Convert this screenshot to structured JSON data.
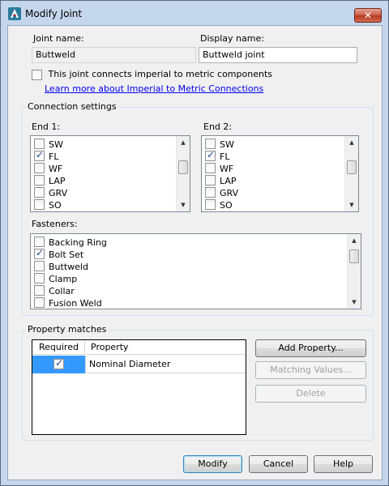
{
  "window": {
    "title": "Modify Joint",
    "close_icon": "✕"
  },
  "joint": {
    "name_label": "Joint name:",
    "name_value": "Buttweld",
    "display_label": "Display name:",
    "display_value": "Buttweld joint",
    "imperial_label": "This joint connects imperial to metric components",
    "imperial_checked": false,
    "learn_more": "Learn more about Imperial to Metric Connections"
  },
  "connection": {
    "group_title": "Connection settings",
    "end1_label": "End 1:",
    "end2_label": "End 2:",
    "end1_items": [
      {
        "label": "SW",
        "checked": false
      },
      {
        "label": "FL",
        "checked": true
      },
      {
        "label": "WF",
        "checked": false
      },
      {
        "label": "LAP",
        "checked": false
      },
      {
        "label": "GRV",
        "checked": false
      },
      {
        "label": "SO",
        "checked": false
      }
    ],
    "end2_items": [
      {
        "label": "SW",
        "checked": false
      },
      {
        "label": "FL",
        "checked": true
      },
      {
        "label": "WF",
        "checked": false
      },
      {
        "label": "LAP",
        "checked": false
      },
      {
        "label": "GRV",
        "checked": false
      },
      {
        "label": "SO",
        "checked": false
      }
    ],
    "fasteners_label": "Fasteners:",
    "fasteners": [
      {
        "label": "Backing Ring",
        "checked": false
      },
      {
        "label": "Bolt Set",
        "checked": true
      },
      {
        "label": "Buttweld",
        "checked": false
      },
      {
        "label": "Clamp",
        "checked": false
      },
      {
        "label": "Collar",
        "checked": false
      },
      {
        "label": "Fusion Weld",
        "checked": false
      }
    ]
  },
  "property_matches": {
    "group_title": "Property matches",
    "col_required": "Required",
    "col_property": "Property",
    "rows": [
      {
        "required": true,
        "property": "Nominal Diameter"
      }
    ],
    "add_property": "Add Property...",
    "matching_values": "Matching Values...",
    "delete": "Delete"
  },
  "footer": {
    "modify": "Modify",
    "cancel": "Cancel",
    "help": "Help"
  }
}
